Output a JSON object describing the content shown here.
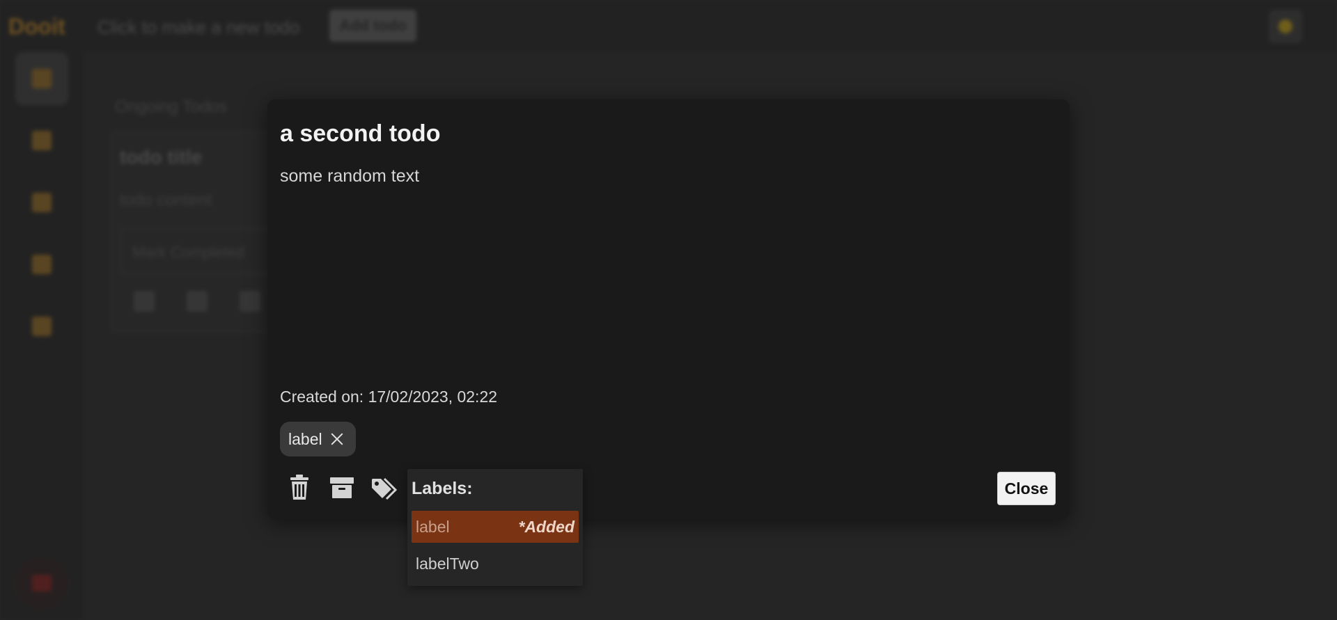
{
  "background": {
    "logo": "Dooit",
    "newtodo_hint": "Click to make a new todo",
    "add_button": "Add todo",
    "section_title": "Ongoing Todos",
    "card": {
      "title": "todo title",
      "content": "todo content",
      "mark_completed": "Mark Completed"
    },
    "sidebar_items": [
      "lightbulb-icon",
      "check-icon",
      "calendar-icon",
      "clipboard-icon",
      "archive-icon"
    ]
  },
  "modal": {
    "title": "a second todo",
    "body": "some random text",
    "created_on": "Created on: 17/02/2023, 02:22",
    "label_chip": "label",
    "close_label": "Close"
  },
  "label_dropdown": {
    "heading": "Labels:",
    "items": [
      {
        "name": "label",
        "note": "*Added",
        "status": "added"
      },
      {
        "name": "labelTwo",
        "note": "",
        "status": "available"
      }
    ]
  },
  "colors": {
    "modal_bg": "#1a1a1a",
    "accent_added": "#7a3414",
    "chip_bg": "#3a3a3a",
    "dropdown_bg": "#262626"
  }
}
